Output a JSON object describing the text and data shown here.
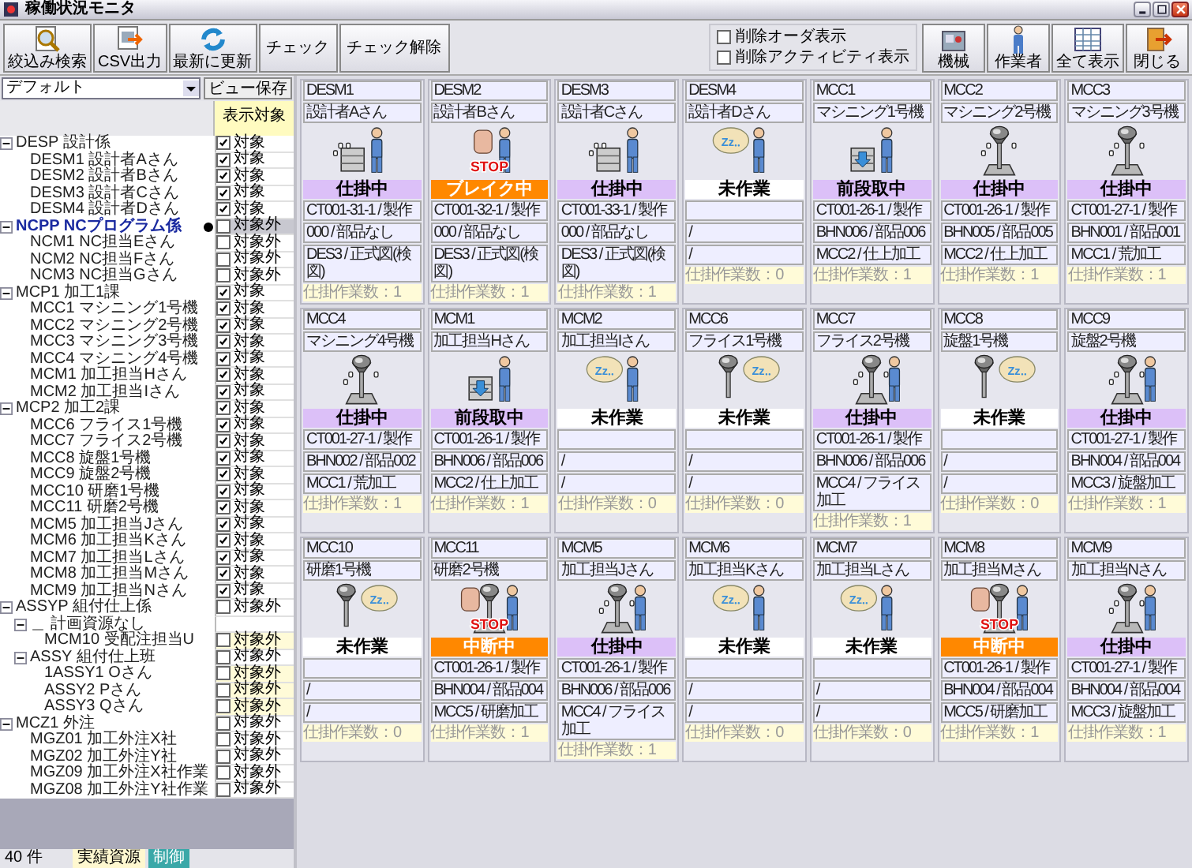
{
  "window": {
    "title": "稼働状況モニタ"
  },
  "toolbar": {
    "buttons": [
      {
        "label": "絞込み検索",
        "kind": "large"
      },
      {
        "label": "CSV出力",
        "kind": "large"
      },
      {
        "label": "最新に更新",
        "kind": "large"
      },
      {
        "label": "チェック",
        "kind": "text"
      },
      {
        "label": "チェック解除",
        "kind": "text"
      }
    ],
    "options": [
      {
        "label": "削除オーダ表示",
        "checked": false
      },
      {
        "label": "削除アクティビティ表示",
        "checked": false
      }
    ],
    "right_buttons": [
      {
        "label": "機械"
      },
      {
        "label": "作業者"
      },
      {
        "label": "全て表示"
      },
      {
        "label": "閉じる"
      }
    ]
  },
  "view": {
    "selector": "デフォルト",
    "save_button": "ビュー保存",
    "column": "表示対象"
  },
  "tree": [
    {
      "label": "DESP 設計係",
      "expanded": true,
      "selected": false,
      "checked": true,
      "target": "対象",
      "children": [
        {
          "label": "DESM1 設計者Aさん",
          "selected": false,
          "checked": true,
          "target": "対象"
        },
        {
          "label": "DESM2 設計者Bさん",
          "selected": false,
          "checked": true,
          "target": "対象"
        },
        {
          "label": "DESM3 設計者Cさん",
          "selected": false,
          "checked": true,
          "target": "対象"
        },
        {
          "label": "DESM4 設計者Dさん",
          "selected": false,
          "checked": true,
          "target": "対象"
        }
      ]
    },
    {
      "label": "NCPP NCプログラム係",
      "expanded": true,
      "selected": true,
      "checked": false,
      "target": "対象外",
      "children": [
        {
          "label": "NCM1 NC担当Eさん",
          "selected": false,
          "checked": false,
          "target": "対象外"
        },
        {
          "label": "NCM2 NC担当Fさん",
          "selected": false,
          "checked": false,
          "target": "対象外"
        },
        {
          "label": "NCM3 NC担当Gさん",
          "selected": false,
          "checked": false,
          "target": "対象外"
        }
      ]
    },
    {
      "label": "MCP1 加工1課",
      "expanded": true,
      "selected": false,
      "checked": true,
      "target": "対象",
      "children": [
        {
          "label": "MCC1 マシニング1号機",
          "selected": false,
          "checked": true,
          "target": "対象"
        },
        {
          "label": "MCC2 マシニング2号機",
          "selected": false,
          "checked": true,
          "target": "対象"
        },
        {
          "label": "MCC3 マシニング3号機",
          "selected": false,
          "checked": true,
          "target": "対象"
        },
        {
          "label": "MCC4 マシニング4号機",
          "selected": false,
          "checked": true,
          "target": "対象"
        },
        {
          "label": "MCM1 加工担当Hさん",
          "selected": false,
          "checked": true,
          "target": "対象"
        },
        {
          "label": "MCM2 加工担当Iさん",
          "selected": false,
          "checked": true,
          "target": "対象"
        }
      ]
    },
    {
      "label": "MCP2 加工2課",
      "expanded": true,
      "selected": false,
      "checked": true,
      "target": "対象",
      "children": [
        {
          "label": "MCC6 フライス1号機",
          "selected": false,
          "checked": true,
          "target": "対象"
        },
        {
          "label": "MCC7 フライス2号機",
          "selected": false,
          "checked": true,
          "target": "対象"
        },
        {
          "label": "MCC8 旋盤1号機",
          "selected": false,
          "checked": true,
          "target": "対象"
        },
        {
          "label": "MCC9 旋盤2号機",
          "selected": false,
          "checked": true,
          "target": "対象"
        },
        {
          "label": "MCC10 研磨1号機",
          "selected": false,
          "checked": true,
          "target": "対象"
        },
        {
          "label": "MCC11 研磨2号機",
          "selected": false,
          "checked": true,
          "target": "対象"
        },
        {
          "label": "MCM5 加工担当Jさん",
          "selected": false,
          "checked": true,
          "target": "対象"
        },
        {
          "label": "MCM6 加工担当Kさん",
          "selected": false,
          "checked": true,
          "target": "対象"
        },
        {
          "label": "MCM7 加工担当Lさん",
          "selected": false,
          "checked": true,
          "target": "対象"
        },
        {
          "label": "MCM8 加工担当Mさん",
          "selected": false,
          "checked": true,
          "target": "対象"
        },
        {
          "label": "MCM9 加工担当Nさん",
          "selected": false,
          "checked": true,
          "target": "対象"
        }
      ]
    },
    {
      "label": "ASSYP 組付仕上係",
      "expanded": true,
      "selected": false,
      "checked": false,
      "target": "対象外",
      "children": [
        {
          "label": "＿ 計画資源なし",
          "expanded": true,
          "selected": false,
          "children": [
            {
              "label": "MCM10 受配注担当U",
              "selected": false,
              "checked": false,
              "target": "対象外",
              "highlight": true
            }
          ]
        },
        {
          "label": "ASSY 組付仕上班",
          "expanded": true,
          "selected": false,
          "checked": false,
          "target": "対象外",
          "children": [
            {
              "label": "1ASSY1 Oさん",
              "selected": false,
              "checked": false,
              "target": "対象外",
              "highlight": true
            },
            {
              "label": "ASSY2 Pさん",
              "selected": false,
              "checked": false,
              "target": "対象外",
              "highlight": true
            },
            {
              "label": "ASSY3 Qさん",
              "selected": false,
              "checked": false,
              "target": "対象外",
              "highlight": true
            }
          ]
        }
      ]
    },
    {
      "label": "MCZ1 外注",
      "expanded": true,
      "selected": false,
      "checked": false,
      "target": "対象外",
      "children": [
        {
          "label": "MGZ01 加工外注X社",
          "selected": false,
          "checked": false,
          "target": "対象外"
        },
        {
          "label": "MGZ02 加工外注Y社",
          "selected": false,
          "checked": false,
          "target": "対象外"
        },
        {
          "label": "MGZ09 加工外注X社作業",
          "selected": false,
          "checked": false,
          "target": "対象外"
        },
        {
          "label": "MGZ08 加工外注Y社作業",
          "selected": false,
          "checked": false,
          "target": "対象外"
        }
      ]
    }
  ],
  "cards": [
    {
      "code": "DESM1",
      "name": "設計者Aさん",
      "kind": "worker",
      "status": {
        "text": "仕掛中",
        "kind": "active"
      },
      "order": "CT001-31-1 / 製作",
      "part": "000 / 部品なし",
      "process": "DES3 / 正式図(検図)",
      "count": "仕掛作業数：1"
    },
    {
      "code": "DESM2",
      "name": "設計者Bさん",
      "kind": "worker",
      "sign_text": "STOP",
      "status": {
        "text": "ブレイク中",
        "kind": "stopped"
      },
      "order": "CT001-32-1 / 製作",
      "part": "000 / 部品なし",
      "process": "DES3 / 正式図(検図)",
      "count": "仕掛作業数：1"
    },
    {
      "code": "DESM3",
      "name": "設計者Cさん",
      "kind": "worker",
      "status": {
        "text": "仕掛中",
        "kind": "active"
      },
      "order": "CT001-33-1 / 製作",
      "part": "000 / 部品なし",
      "process": "DES3 / 正式図(検図)",
      "count": "仕掛作業数：1"
    },
    {
      "code": "DESM4",
      "name": "設計者Dさん",
      "kind": "worker",
      "sign_text": "Zz‥",
      "status": {
        "text": "未作業",
        "kind": "idle"
      },
      "part": "/",
      "process": "/",
      "count": "仕掛作業数：0"
    },
    {
      "code": "MCC1",
      "name": "マシニング1号機",
      "kind": "worker",
      "status": {
        "text": "前段取中",
        "kind": "setup"
      },
      "order": "CT001-26-1 / 製作",
      "part": "BHN006 / 部品006",
      "process": "MCC2 / 仕上加工",
      "count": "仕掛作業数：1"
    },
    {
      "code": "MCC2",
      "name": "マシニング2号機",
      "kind": "machine",
      "status": {
        "text": "仕掛中",
        "kind": "active"
      },
      "order": "CT001-26-1 / 製作",
      "part": "BHN005 / 部品005",
      "process": "MCC2 / 仕上加工",
      "count": "仕掛作業数：1"
    },
    {
      "code": "MCC3",
      "name": "マシニング3号機",
      "kind": "machine",
      "status": {
        "text": "仕掛中",
        "kind": "active"
      },
      "order": "CT001-27-1 / 製作",
      "part": "BHN001 / 部品001",
      "process": "MCC1 / 荒加工",
      "count": "仕掛作業数：1"
    },
    {
      "code": "MCC4",
      "name": "マシニング4号機",
      "kind": "machine",
      "status": {
        "text": "仕掛中",
        "kind": "active"
      },
      "order": "CT001-27-1 / 製作",
      "part": "BHN002 / 部品002",
      "process": "MCC1 / 荒加工",
      "count": "仕掛作業数：1"
    },
    {
      "code": "MCM1",
      "name": "加工担当Hさん",
      "kind": "worker",
      "status": {
        "text": "前段取中",
        "kind": "setup"
      },
      "order": "CT001-26-1 / 製作",
      "part": "BHN006 / 部品006",
      "process": "MCC2 / 仕上加工",
      "count": "仕掛作業数：1"
    },
    {
      "code": "MCM2",
      "name": "加工担当Iさん",
      "kind": "worker",
      "sign_text": "Zz‥",
      "status": {
        "text": "未作業",
        "kind": "idle"
      },
      "part": "/",
      "process": "/",
      "count": "仕掛作業数：0"
    },
    {
      "code": "MCC6",
      "name": "フライス1号機",
      "kind": "machine",
      "sign_text": "Zz‥",
      "status": {
        "text": "未作業",
        "kind": "idle"
      },
      "part": "/",
      "process": "/",
      "count": "仕掛作業数：0"
    },
    {
      "code": "MCC7",
      "name": "フライス2号機",
      "kind": "machine_worker",
      "status": {
        "text": "仕掛中",
        "kind": "active"
      },
      "order": "CT001-26-1 / 製作",
      "part": "BHN006 / 部品006",
      "process": "MCC4 / フライス加工",
      "count": "仕掛作業数：1"
    },
    {
      "code": "MCC8",
      "name": "旋盤1号機",
      "kind": "machine",
      "sign_text": "Zz‥",
      "status": {
        "text": "未作業",
        "kind": "idle"
      },
      "part": "/",
      "process": "/",
      "count": "仕掛作業数：0"
    },
    {
      "code": "MCC9",
      "name": "旋盤2号機",
      "kind": "machine_worker",
      "status": {
        "text": "仕掛中",
        "kind": "active"
      },
      "order": "CT001-27-1 / 製作",
      "part": "BHN004 / 部品004",
      "process": "MCC3 / 旋盤加工",
      "count": "仕掛作業数：1"
    },
    {
      "code": "MCC10",
      "name": "研磨1号機",
      "kind": "machine",
      "sign_text": "Zz‥",
      "status": {
        "text": "未作業",
        "kind": "idle"
      },
      "part": "/",
      "process": "/",
      "count": "仕掛作業数：0"
    },
    {
      "code": "MCC11",
      "name": "研磨2号機",
      "kind": "machine_worker",
      "sign_text": "STOP",
      "status": {
        "text": "中断中",
        "kind": "stopped"
      },
      "order": "CT001-26-1 / 製作",
      "part": "BHN004 / 部品004",
      "process": "MCC5 / 研磨加工",
      "count": "仕掛作業数：1"
    },
    {
      "code": "MCM5",
      "name": "加工担当Jさん",
      "kind": "machine_worker",
      "status": {
        "text": "仕掛中",
        "kind": "active"
      },
      "order": "CT001-26-1 / 製作",
      "part": "BHN006 / 部品006",
      "process": "MCC4 / フライス加工",
      "count": "仕掛作業数：1"
    },
    {
      "code": "MCM6",
      "name": "加工担当Kさん",
      "kind": "worker",
      "sign_text": "Zz‥",
      "status": {
        "text": "未作業",
        "kind": "idle"
      },
      "part": "/",
      "process": "/",
      "count": "仕掛作業数：0"
    },
    {
      "code": "MCM7",
      "name": "加工担当Lさん",
      "kind": "worker",
      "sign_text": "Zz‥",
      "status": {
        "text": "未作業",
        "kind": "idle"
      },
      "part": "/",
      "process": "/",
      "count": "仕掛作業数：0"
    },
    {
      "code": "MCM8",
      "name": "加工担当Mさん",
      "kind": "machine_worker",
      "sign_text": "STOP",
      "status": {
        "text": "中断中",
        "kind": "stopped"
      },
      "order": "CT001-26-1 / 製作",
      "part": "BHN004 / 部品004",
      "process": "MCC5 / 研磨加工",
      "count": "仕掛作業数：1"
    },
    {
      "code": "MCM9",
      "name": "加工担当Nさん",
      "kind": "machine_worker",
      "status": {
        "text": "仕掛中",
        "kind": "active"
      },
      "order": "CT001-27-1 / 製作",
      "part": "BHN004 / 部品004",
      "process": "MCC3 / 旋盤加工",
      "count": "仕掛作業数：1"
    }
  ],
  "status_bar": {
    "count": "40 件",
    "source": "実績資源",
    "mode": "制御"
  }
}
